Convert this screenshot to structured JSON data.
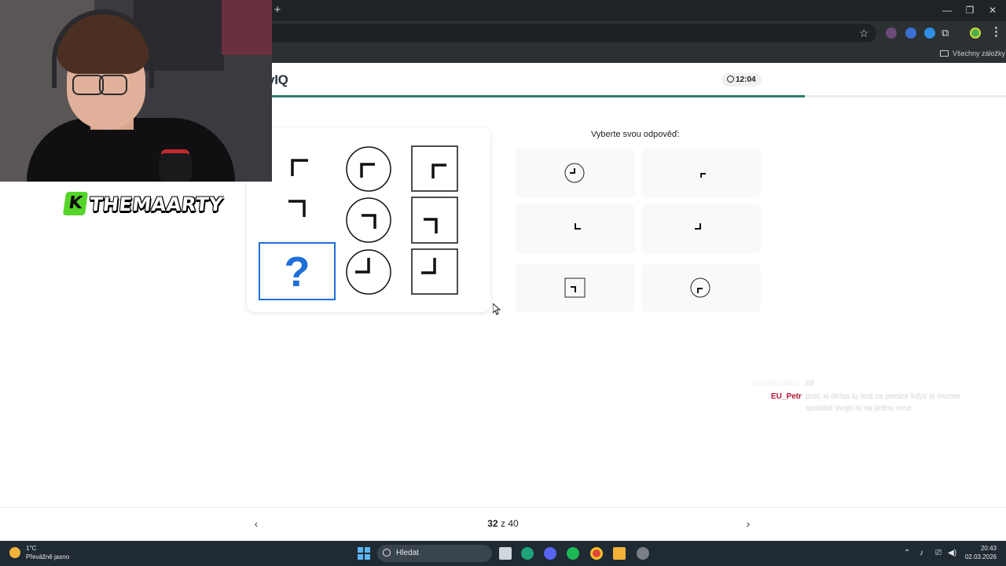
{
  "browser": {
    "new_tab_glyph": "+",
    "window_controls": [
      "—",
      "❐",
      "✕"
    ],
    "bookmark_star_glyph": "☆",
    "extensions_glyph": "⧉",
    "menu_glyph": "⋮",
    "bookmarks_folder_label": "Všechny záložky"
  },
  "site": {
    "logo_text": "nyIQ",
    "timer_text": "12:04",
    "progress": 0.8
  },
  "puzzle": {
    "question_mark": "?"
  },
  "answers": {
    "prompt": "Vyberte svou odpověď:"
  },
  "pagination": {
    "prev_glyph": "‹",
    "next_glyph": "›",
    "current": "32",
    "separator": " z ",
    "total": "40"
  },
  "stream_overlay": {
    "brand_letter": "K",
    "brand_name": "THEMAARTY"
  },
  "chat": {
    "messages": [
      {
        "user": "paveljordan1",
        "text": "xd",
        "user_color": "#f1f3f5"
      },
      {
        "user": "EU_Petr",
        "text": "proc si delas iq test za penize kdyz si muzes spocitat svoje iq na jednu ruce",
        "user_color": "#b3122e"
      }
    ]
  },
  "taskbar": {
    "weather_temp": "1°C",
    "weather_desc": "Převážně jasno",
    "search_placeholder": "Hledat",
    "tray_glyphs": [
      "⌃",
      "♪",
      "⎚",
      "◀)"
    ],
    "time": "20:43",
    "date": "02.03.2026"
  },
  "colors": {
    "accent_blue": "#1e6fd9",
    "progress_green": "#2e7d6e",
    "brand_green": "#55d42a"
  }
}
